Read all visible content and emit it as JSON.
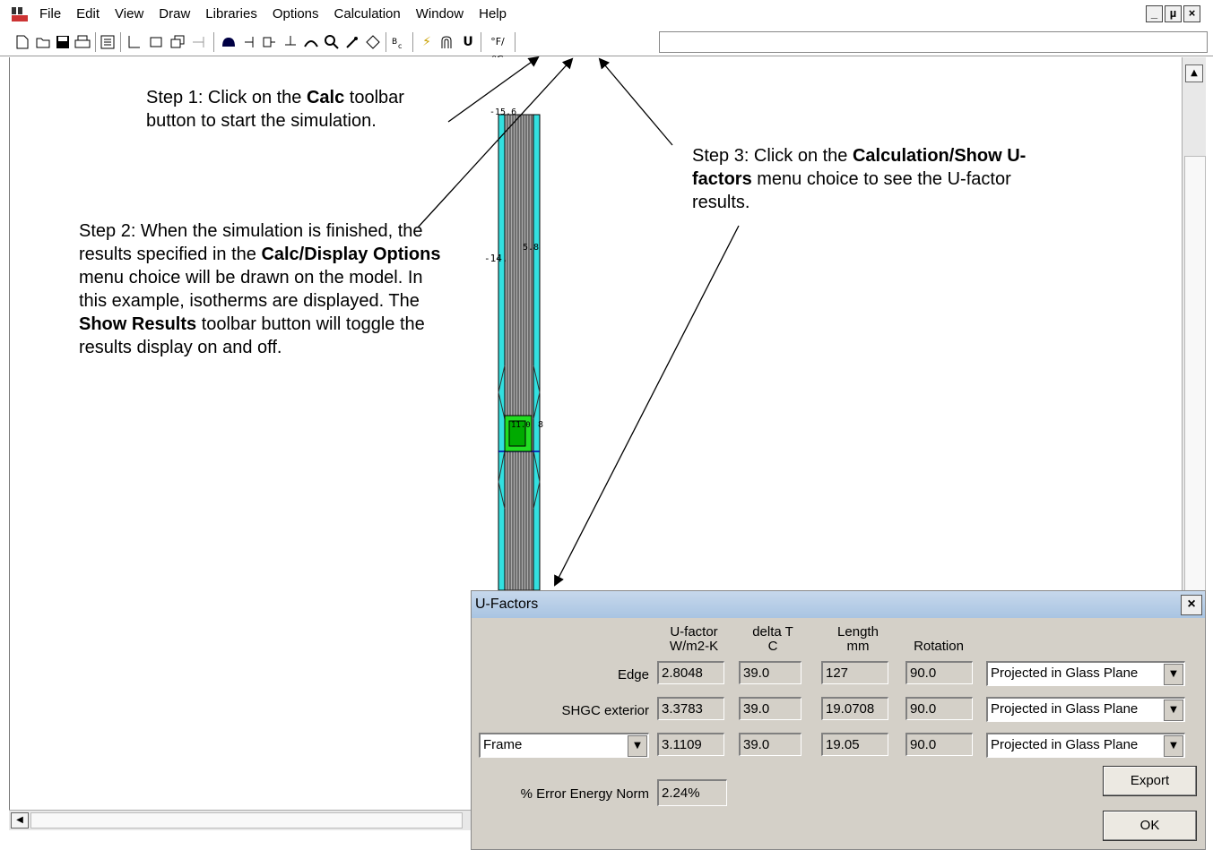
{
  "menubar": {
    "app_icon_text": "THERM",
    "items": [
      "File",
      "Edit",
      "View",
      "Draw",
      "Libraries",
      "Options",
      "Calculation",
      "Window",
      "Help"
    ],
    "window_buttons": [
      "_",
      "µ",
      "×"
    ]
  },
  "toolbar": {
    "buttons": [
      {
        "name": "new-icon",
        "glyph": "🗋"
      },
      {
        "name": "open-icon",
        "glyph": "📂"
      },
      {
        "name": "save-icon",
        "glyph": "💾"
      },
      {
        "name": "print-icon",
        "glyph": "🖨"
      }
    ],
    "calc_glyph": "⚡",
    "show_results_glyph": "∇",
    "ufactor_glyph": "U",
    "boundary_glyph": "°F/°C"
  },
  "steps": {
    "step1": {
      "pre": "Step 1: Click on the ",
      "bold": "Calc",
      "post": " toolbar button to start the simulation."
    },
    "step2": {
      "p1": "Step 2: When the simulation is finished, the results specified in the ",
      "b1": "Calc/Display Options",
      "p2": " menu choice will be drawn on the model. In this example, isotherms are displayed. The ",
      "b2": "Show Results",
      "p3": " toolbar button will toggle the results display on and off."
    },
    "step3": {
      "pre": "Step 3: Click on the ",
      "bold": "Calculation/Show U-factors",
      "post": " menu choice to see the U-factor results."
    }
  },
  "model_labels": {
    "top": "-15.6",
    "mid_left": "-14.",
    "mid_right": "5.8",
    "green_label": "11.0",
    "green_right": "8"
  },
  "dialog": {
    "title": "U-Factors",
    "close": "×",
    "headers": {
      "ufactor": "U-factor",
      "ufactor_unit": "W/m2-K",
      "deltat": "delta T",
      "deltat_unit": "C",
      "length": "Length",
      "length_unit": "mm",
      "rotation": "Rotation"
    },
    "rows": [
      {
        "label": "Edge",
        "ufactor": "2.8048",
        "deltat": "39.0",
        "length": "127",
        "rotation": "90.0",
        "projection": "Projected in Glass Plane"
      },
      {
        "label": "SHGC exterior",
        "ufactor": "3.3783",
        "deltat": "39.0",
        "length": "19.0708",
        "rotation": "90.0",
        "projection": "Projected in Glass Plane"
      },
      {
        "label": "Frame",
        "ufactor": "3.1109",
        "deltat": "39.0",
        "length": "19.05",
        "rotation": "90.0",
        "projection": "Projected in Glass Plane"
      }
    ],
    "error_label": "% Error Energy Norm",
    "error_value": "2.24%",
    "export_label": "Export",
    "ok_label": "OK"
  },
  "colors": {
    "glass": "#33e0e0",
    "frame_core": "#a8a8a8",
    "results_green": "#22dd22",
    "dialog_bg": "#d4d0c8"
  }
}
